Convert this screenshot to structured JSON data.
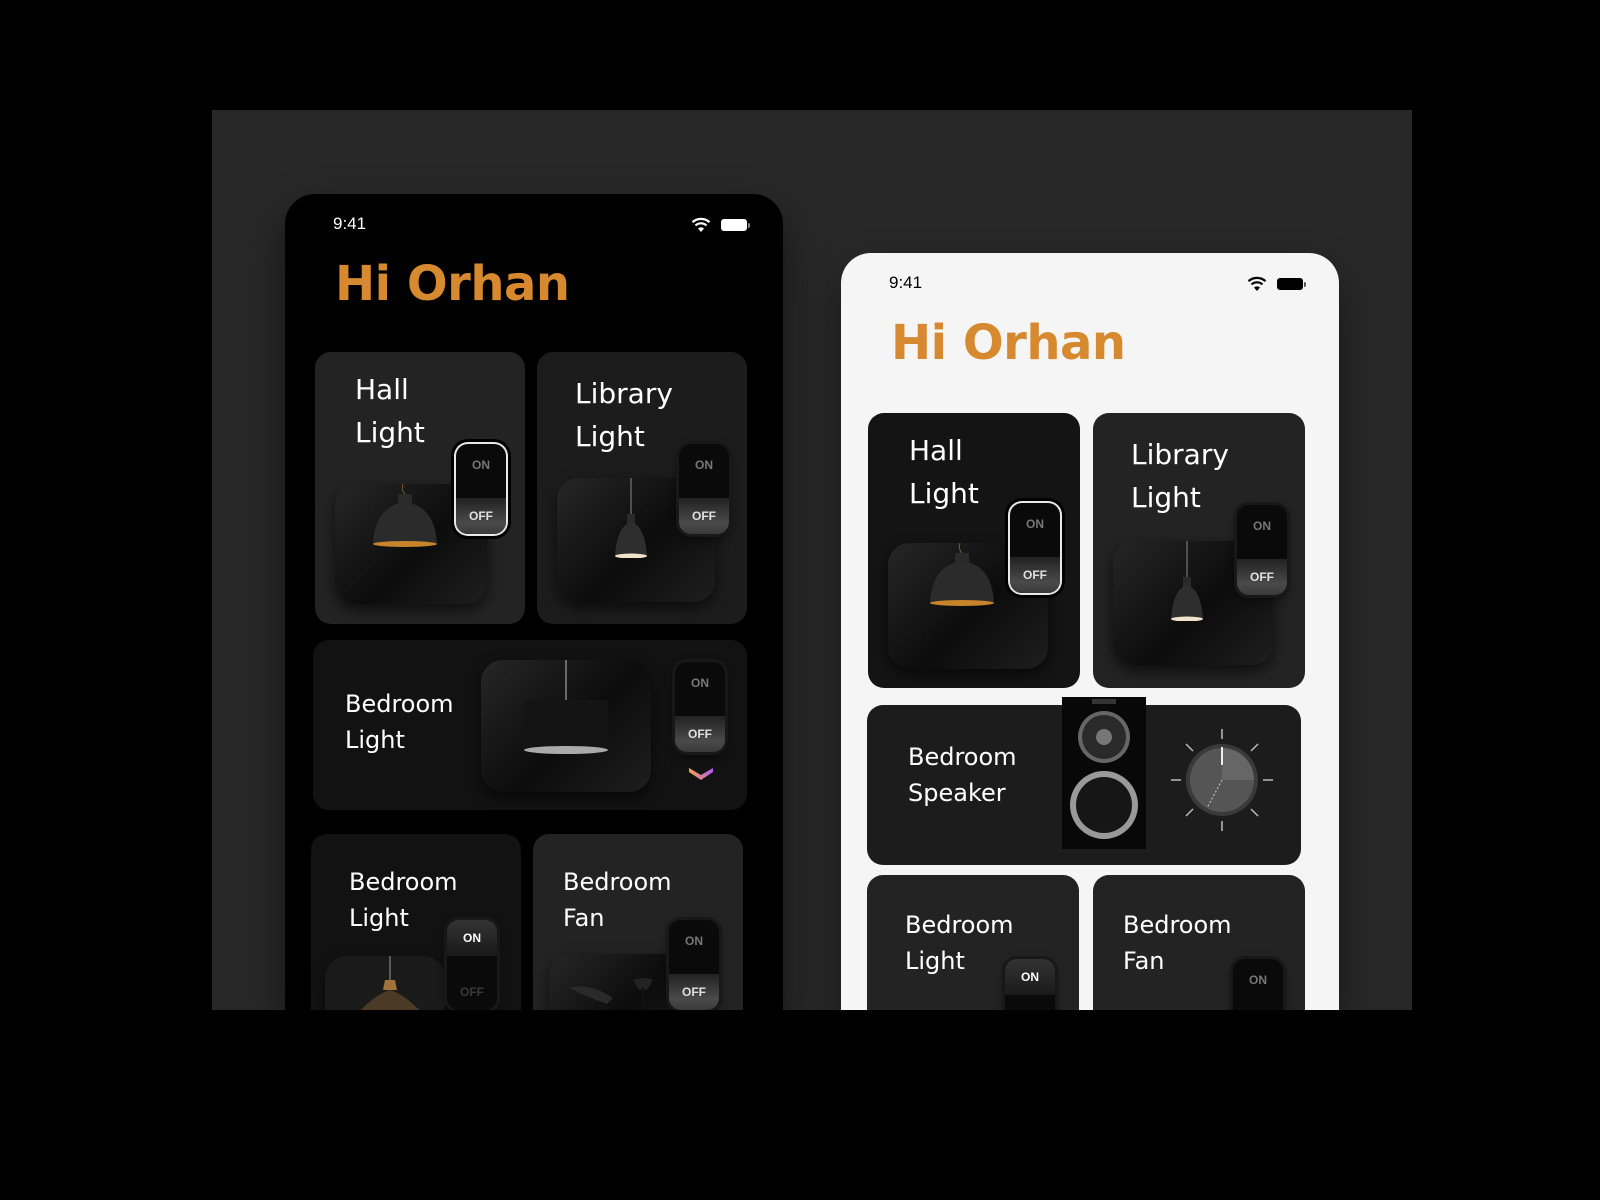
{
  "accent_color": "#d6892e",
  "dark_phone": {
    "status": {
      "time": "9:41",
      "wifi_icon": "wifi-icon",
      "battery_icon": "battery-icon"
    },
    "greeting": "Hi Orhan",
    "cards": [
      {
        "title": "Hall\nLight",
        "switch": {
          "on": "ON",
          "off": "OFF",
          "state": "off"
        },
        "image": "dome-pendant-lamp"
      },
      {
        "title": "Library\nLight",
        "switch": {
          "on": "ON",
          "off": "OFF",
          "state": "off"
        },
        "image": "narrow-pendant-lamp"
      },
      {
        "title": "Bedroom\nLight",
        "switch": {
          "on": "ON",
          "off": "OFF",
          "state": "off"
        },
        "image": "drum-pendant-lamp",
        "expand_icon": "chevron-down-icon"
      },
      {
        "title": "Bedroom\nLight",
        "switch": {
          "on": "ON",
          "off": "OFF",
          "state": "on"
        },
        "image": "brass-pendant-lamp"
      },
      {
        "title": "Bedroom\nFan",
        "switch": {
          "on": "ON",
          "off": "OFF",
          "state": "off"
        },
        "image": "ceiling-fan"
      }
    ]
  },
  "light_phone": {
    "status": {
      "time": "9:41",
      "wifi_icon": "wifi-icon",
      "battery_icon": "battery-icon"
    },
    "greeting": "Hi Orhan",
    "cards": [
      {
        "title": "Hall\nLight",
        "switch": {
          "on": "ON",
          "off": "OFF",
          "state": "off"
        },
        "image": "dome-pendant-lamp"
      },
      {
        "title": "Library\nLight",
        "switch": {
          "on": "ON",
          "off": "OFF",
          "state": "off"
        },
        "image": "narrow-pendant-lamp"
      },
      {
        "title": "Bedroom\nSpeaker",
        "image": "bookshelf-speaker",
        "control": "volume-knob"
      },
      {
        "title": "Bedroom\nLight",
        "switch": {
          "on": "ON",
          "state": "on"
        }
      },
      {
        "title": "Bedroom\nFan",
        "switch": {
          "on": "ON",
          "state": "off"
        }
      }
    ]
  }
}
